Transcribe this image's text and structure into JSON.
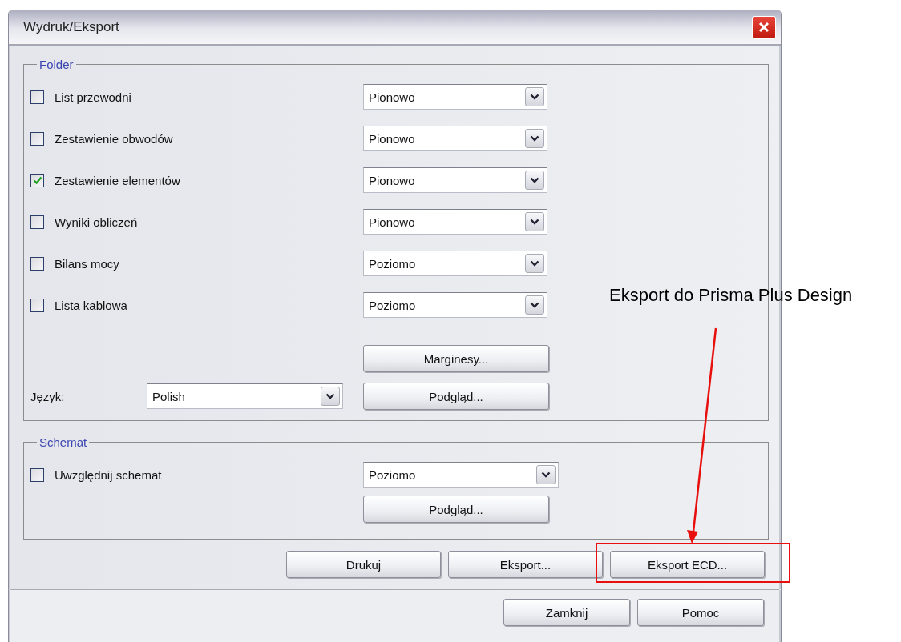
{
  "window": {
    "title": "Wydruk/Eksport"
  },
  "folder": {
    "legend": "Folder",
    "items": [
      {
        "label": "List przewodni",
        "checked": false,
        "orientation": "Pionowo"
      },
      {
        "label": "Zestawienie obwodów",
        "checked": false,
        "orientation": "Pionowo"
      },
      {
        "label": "Zestawienie elementów",
        "checked": true,
        "orientation": "Pionowo"
      },
      {
        "label": "Wyniki obliczeń",
        "checked": false,
        "orientation": "Pionowo"
      },
      {
        "label": "Bilans mocy",
        "checked": false,
        "orientation": "Poziomo"
      },
      {
        "label": "Lista kablowa",
        "checked": false,
        "orientation": "Poziomo"
      }
    ],
    "margins_button": "Marginesy...",
    "language": {
      "label": "Język:",
      "value": "Polish"
    },
    "preview_button": "Podgląd..."
  },
  "schema": {
    "legend": "Schemat",
    "include": {
      "label": "Uwzględnij schemat",
      "checked": false
    },
    "orientation": "Poziomo",
    "preview_button": "Podgląd..."
  },
  "action_buttons": [
    "Drukuj",
    "Eksport...",
    "Eksport ECD..."
  ],
  "dialog_buttons": [
    "Zamknij",
    "Pomoc"
  ],
  "annotation": {
    "text": "Eksport do Prisma Plus Design"
  }
}
